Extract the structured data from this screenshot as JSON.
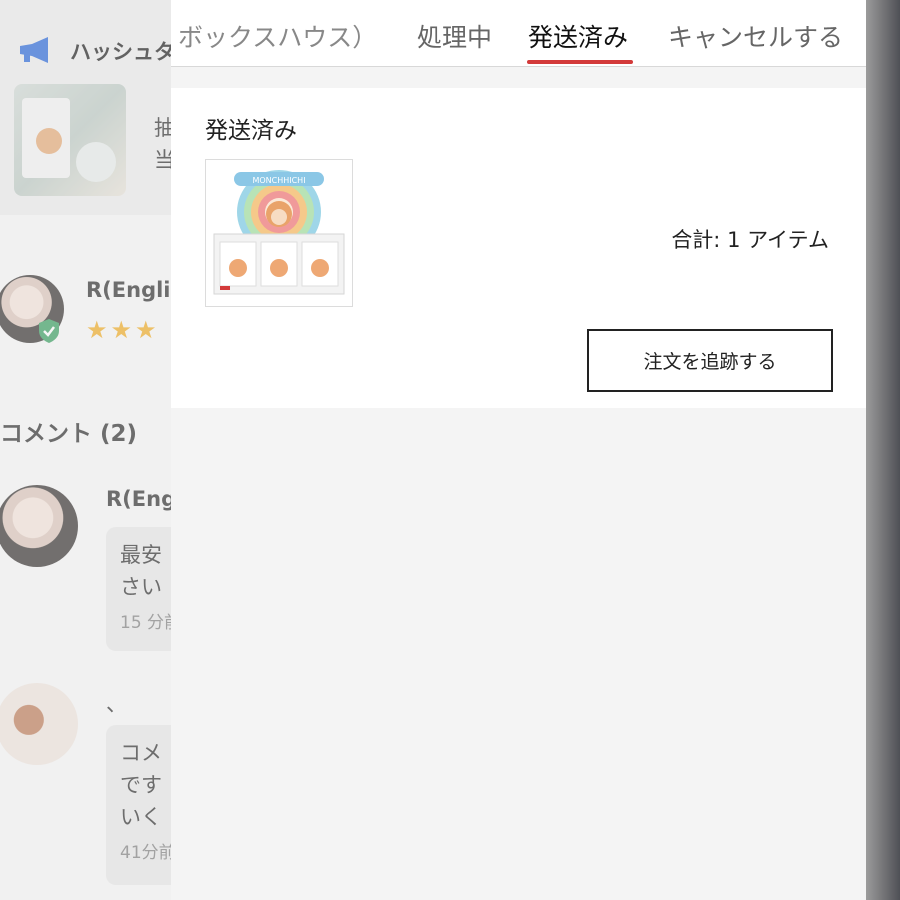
{
  "background": {
    "notice": {
      "title": "ハッシュタ",
      "text_lines": [
        "抽",
        "当"
      ]
    },
    "review": {
      "reviewer_name": "R(Engli",
      "stars": "★★★"
    },
    "comments": {
      "header": "コメント (2)",
      "items": [
        {
          "name": "R(Eng",
          "lines": [
            "最安",
            "さい"
          ],
          "time": "15 分前"
        },
        {
          "name": "、",
          "lines": [
            "コメ",
            "です",
            "いく"
          ],
          "time": "41分前"
        }
      ]
    }
  },
  "order_panel": {
    "tabs": [
      {
        "label": "ボックスハウス）",
        "active": false
      },
      {
        "label": "処理中",
        "active": false
      },
      {
        "label": "発送済み",
        "active": true
      },
      {
        "label": "キャンセルする",
        "active": false
      }
    ],
    "accent_color": "#d33a3a",
    "order": {
      "status": "発送済み",
      "total": "合計: 1 アイテム",
      "track_button": "注文を追跡する",
      "product_image": {
        "icon": "blind-box-display-image",
        "box_text": "MONCHHICHI"
      }
    }
  }
}
